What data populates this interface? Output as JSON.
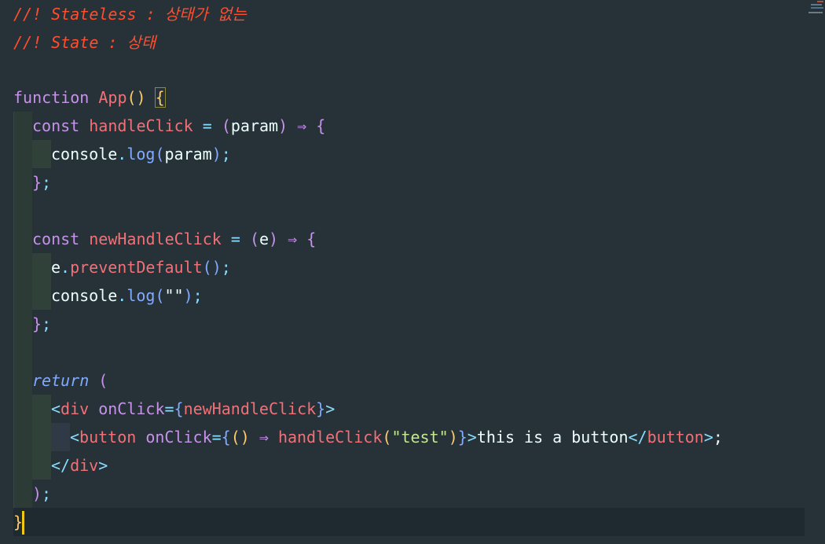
{
  "editor": {
    "lines": [
      {
        "tokens": [
          {
            "c": "comment",
            "t": "//! Stateless : 상태가 없는"
          }
        ]
      },
      {
        "tokens": [
          {
            "c": "comment",
            "t": "//! State : 상태"
          }
        ]
      },
      {
        "tokens": []
      },
      {
        "tokens": [
          {
            "c": "kw",
            "t": "function "
          },
          {
            "c": "fn",
            "t": "App"
          },
          {
            "c": "yellow",
            "t": "() "
          },
          {
            "c": "yellow bracket-box",
            "t": "{"
          }
        ]
      },
      {
        "tokens": [
          {
            "c": "kw",
            "t": "const "
          },
          {
            "c": "fn",
            "t": "handleClick"
          },
          {
            "c": "punct",
            "t": " = "
          },
          {
            "c": "pm",
            "t": "("
          },
          {
            "c": "plain",
            "t": "param"
          },
          {
            "c": "pm",
            "t": ")"
          },
          {
            "c": "arrow",
            "t": " ⇒ "
          },
          {
            "c": "pm",
            "t": "{"
          }
        ]
      },
      {
        "tokens": [
          {
            "c": "plain",
            "t": "console"
          },
          {
            "c": "punct",
            "t": "."
          },
          {
            "c": "fncall",
            "t": "log"
          },
          {
            "c": "fncall",
            "t": "("
          },
          {
            "c": "plain",
            "t": "param"
          },
          {
            "c": "fncall",
            "t": ")"
          },
          {
            "c": "punct",
            "t": ";"
          }
        ]
      },
      {
        "tokens": [
          {
            "c": "pm",
            "t": "}"
          },
          {
            "c": "punct",
            "t": ";"
          }
        ]
      },
      {
        "tokens": []
      },
      {
        "tokens": [
          {
            "c": "kw",
            "t": "const "
          },
          {
            "c": "fn",
            "t": "newHandleClick"
          },
          {
            "c": "punct",
            "t": " = "
          },
          {
            "c": "pm",
            "t": "("
          },
          {
            "c": "plain",
            "t": "e"
          },
          {
            "c": "pm",
            "t": ")"
          },
          {
            "c": "arrow",
            "t": " ⇒ "
          },
          {
            "c": "pm",
            "t": "{"
          }
        ]
      },
      {
        "tokens": [
          {
            "c": "plain",
            "t": "e"
          },
          {
            "c": "punct",
            "t": "."
          },
          {
            "c": "fn",
            "t": "preventDefault"
          },
          {
            "c": "fncall",
            "t": "()"
          },
          {
            "c": "punct",
            "t": ";"
          }
        ]
      },
      {
        "tokens": [
          {
            "c": "plain",
            "t": "console"
          },
          {
            "c": "punct",
            "t": "."
          },
          {
            "c": "fncall",
            "t": "log"
          },
          {
            "c": "fncall",
            "t": "("
          },
          {
            "c": "plain",
            "t": "\"\""
          },
          {
            "c": "fncall",
            "t": ")"
          },
          {
            "c": "punct",
            "t": ";"
          }
        ]
      },
      {
        "tokens": [
          {
            "c": "pm",
            "t": "}"
          },
          {
            "c": "punct",
            "t": ";"
          }
        ]
      },
      {
        "tokens": []
      },
      {
        "tokens": [
          {
            "c": "ret",
            "t": "return"
          },
          {
            "c": "pm",
            "t": " ("
          }
        ]
      },
      {
        "tokens": [
          {
            "c": "punct",
            "t": "<"
          },
          {
            "c": "tag",
            "t": "div"
          },
          {
            "c": "attr",
            "t": " onClick"
          },
          {
            "c": "punct",
            "t": "="
          },
          {
            "c": "fncall",
            "t": "{"
          },
          {
            "c": "fn",
            "t": "newHandleClick"
          },
          {
            "c": "fncall",
            "t": "}"
          },
          {
            "c": "punct",
            "t": ">"
          }
        ]
      },
      {
        "tokens": [
          {
            "c": "punct",
            "t": "<"
          },
          {
            "c": "tag",
            "t": "button"
          },
          {
            "c": "attr",
            "t": " onClick"
          },
          {
            "c": "punct",
            "t": "="
          },
          {
            "c": "fncall",
            "t": "{"
          },
          {
            "c": "yellow",
            "t": "()"
          },
          {
            "c": "arrow",
            "t": " ⇒ "
          },
          {
            "c": "fn",
            "t": "handleClick"
          },
          {
            "c": "yellow",
            "t": "("
          },
          {
            "c": "str",
            "t": "\"test\""
          },
          {
            "c": "yellow",
            "t": ")"
          },
          {
            "c": "fncall",
            "t": "}"
          },
          {
            "c": "punct",
            "t": ">"
          },
          {
            "c": "plain",
            "t": "this is a button"
          },
          {
            "c": "punct",
            "t": "</"
          },
          {
            "c": "tag",
            "t": "button"
          },
          {
            "c": "punct",
            "t": ">"
          },
          {
            "c": "plain",
            "t": ";"
          }
        ]
      },
      {
        "tokens": [
          {
            "c": "punct",
            "t": "</"
          },
          {
            "c": "tag",
            "t": "div"
          },
          {
            "c": "punct",
            "t": ">"
          }
        ]
      },
      {
        "tokens": [
          {
            "c": "pm",
            "t": ")"
          },
          {
            "c": "punct",
            "t": ";"
          }
        ]
      },
      {
        "tokens": [
          {
            "c": "yellow",
            "t": "}"
          }
        ]
      }
    ]
  }
}
